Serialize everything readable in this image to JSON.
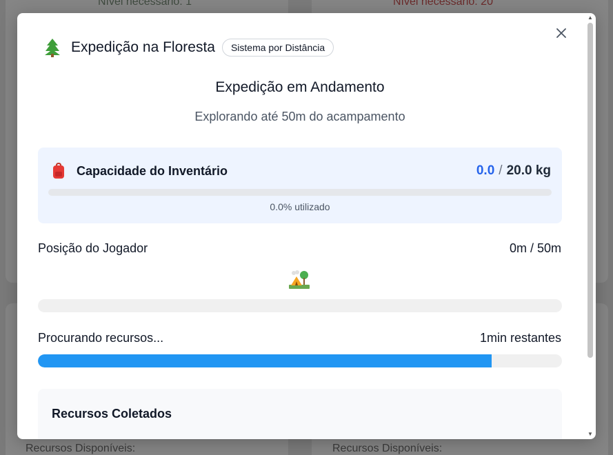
{
  "background": {
    "required_level_left": "Nível necessário: 1",
    "required_level_right": "Nível necessário: 20",
    "available_left": "Recursos Disponíveis:",
    "available_right": "Recursos Disponíveis:"
  },
  "modal": {
    "title": "Expedição na Floresta",
    "badge": "Sistema por Distância",
    "close_icon": "close-icon",
    "tree_icon": "tree-icon"
  },
  "expedition": {
    "status_title": "Expedição em Andamento",
    "subtitle": "Explorando até 50m do acampamento"
  },
  "inventory": {
    "title": "Capacidade do Inventário",
    "current": "0.0",
    "separator": "/",
    "max": "20.0 kg",
    "used_fraction": 0.0,
    "used_text": "0.0% utilizado",
    "icon": "backpack-icon"
  },
  "position": {
    "label": "Posição do Jogador",
    "value": "0m / 50m",
    "progress_fraction": 0.0,
    "icon": "camping-icon"
  },
  "search": {
    "label": "Procurando recursos...",
    "remaining": "1min restantes",
    "progress_fraction": 0.866
  },
  "resources": {
    "title": "Recursos Coletados"
  },
  "colors": {
    "accent_blue": "#2196f3",
    "inventory_blue": "#2563eb",
    "inventory_bg": "#eef4ff"
  }
}
